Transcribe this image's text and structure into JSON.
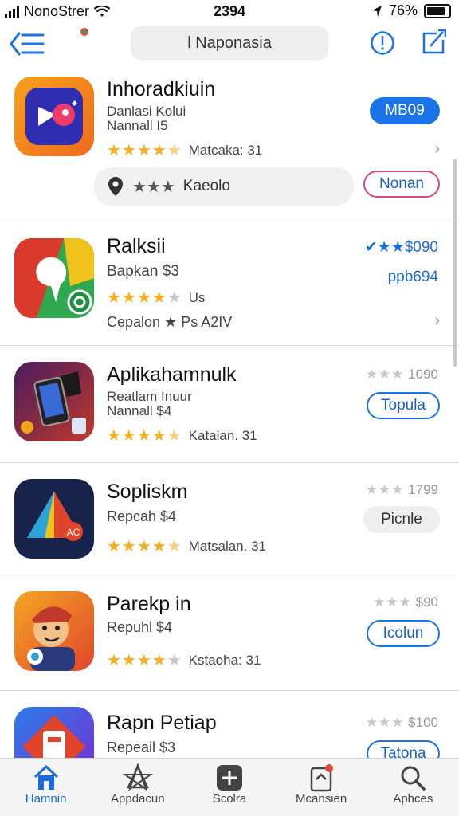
{
  "status_bar": {
    "carrier": "NonoStrer",
    "time": "2394",
    "battery": "76%"
  },
  "nav": {
    "search_text": "l Naponasia"
  },
  "apps": [
    {
      "title": "Inhoradkiuin",
      "sub1": "Danlasi Kolui",
      "sub2": "Nannall I5",
      "stars": "★★★★",
      "stars_dim": "",
      "rating_text": "Matcaka: 31",
      "button": "MB09"
    },
    {
      "title": "Ralksii",
      "sub1": "Bapkan $3",
      "stars": "★★★★",
      "stars_dim": "★",
      "rating_text": "Us",
      "right_top": "✔★★$090",
      "right_mid": "ppb694",
      "extra": "Cepalon ★ Ps A2IV"
    },
    {
      "title": "Aplikahamnulk",
      "sub1": "Reatlam Inuur",
      "sub2": "Nannall $4",
      "stars": "★★★★",
      "stars_dim": "",
      "rating_text": "Katalan. 31",
      "right_stars": "★★★",
      "right_num": "1090",
      "button": "Topula"
    },
    {
      "title": "Sopliskm",
      "sub1": "Repcah $4",
      "stars": "★★★★",
      "stars_dim": "",
      "rating_text": "Matsalan. 31",
      "right_stars": "★★★",
      "right_num": "1799",
      "button": "Picnle"
    },
    {
      "title": "Parekp in",
      "sub1": "Repuhl $4",
      "stars": "★★★★",
      "stars_dim": "★",
      "rating_text": "Kstaoha: 31",
      "right_stars": "★★★",
      "right_num": "$90",
      "button": "Icolun"
    },
    {
      "title": "Rapn Petiap",
      "sub1": "Repeail $3",
      "right_stars": "★★★",
      "right_num": "$100",
      "button": "Tatona"
    }
  ],
  "review_bar": {
    "stars": "★★★",
    "text": "Kaeolo",
    "button": "Nonan"
  },
  "tabs": [
    {
      "label": "Hamnin",
      "icon": "home-icon",
      "active": true
    },
    {
      "label": "Appdacun",
      "icon": "apps-icon",
      "active": false
    },
    {
      "label": "Scolra",
      "icon": "plus-icon",
      "active": false
    },
    {
      "label": "Mcansien",
      "icon": "updates-icon",
      "active": false
    },
    {
      "label": "Aphces",
      "icon": "search-icon",
      "active": false
    }
  ],
  "colors": {
    "accent": "#1a73e8",
    "star": "#f2b01e"
  }
}
